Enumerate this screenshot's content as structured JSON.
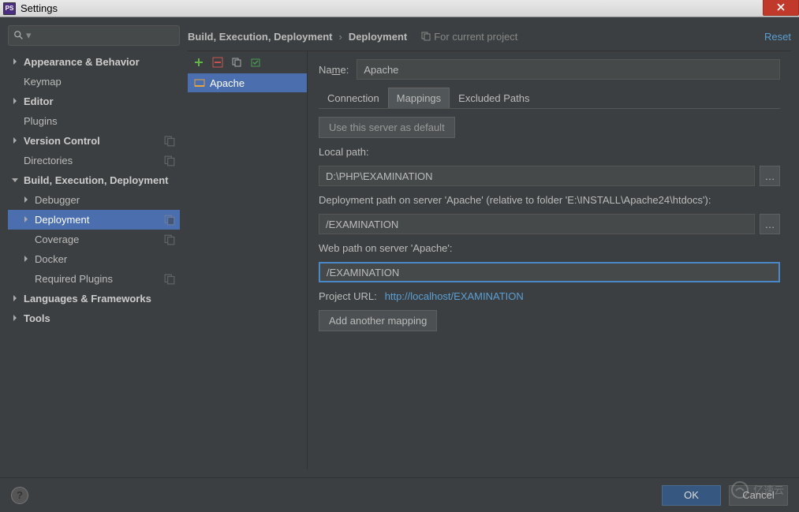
{
  "window": {
    "title": "Settings",
    "icon_text": "PS"
  },
  "search": {
    "placeholder": ""
  },
  "sidebar": {
    "items": [
      {
        "label": "Appearance & Behavior",
        "arrow": "right",
        "bold": true,
        "indent": 0
      },
      {
        "label": "Keymap",
        "arrow": "none",
        "bold": false,
        "indent": 0
      },
      {
        "label": "Editor",
        "arrow": "right",
        "bold": true,
        "indent": 0
      },
      {
        "label": "Plugins",
        "arrow": "none",
        "bold": false,
        "indent": 0
      },
      {
        "label": "Version Control",
        "arrow": "right",
        "bold": true,
        "indent": 0,
        "copy": true
      },
      {
        "label": "Directories",
        "arrow": "none",
        "bold": false,
        "indent": 0,
        "copy": true
      },
      {
        "label": "Build, Execution, Deployment",
        "arrow": "down",
        "bold": true,
        "indent": 0
      },
      {
        "label": "Debugger",
        "arrow": "right",
        "bold": false,
        "indent": 1
      },
      {
        "label": "Deployment",
        "arrow": "right",
        "bold": false,
        "indent": 1,
        "selected": true,
        "copy": true
      },
      {
        "label": "Coverage",
        "arrow": "none",
        "bold": false,
        "indent": 1,
        "copy": true
      },
      {
        "label": "Docker",
        "arrow": "right",
        "bold": false,
        "indent": 1
      },
      {
        "label": "Required Plugins",
        "arrow": "none",
        "bold": false,
        "indent": 1,
        "copy": true
      },
      {
        "label": "Languages & Frameworks",
        "arrow": "right",
        "bold": true,
        "indent": 0
      },
      {
        "label": "Tools",
        "arrow": "right",
        "bold": true,
        "indent": 0
      }
    ]
  },
  "breadcrumb": {
    "part1": "Build, Execution, Deployment",
    "part2": "Deployment",
    "for_project": "For current project",
    "reset": "Reset"
  },
  "servers": {
    "items": [
      {
        "name": "Apache"
      }
    ]
  },
  "detail": {
    "name_label_u": "m",
    "name_label_pre": "Na",
    "name_label_post": "e:",
    "name_value": "Apache",
    "tabs": {
      "connection": "Connection",
      "mappings": "Mappings",
      "excluded": "Excluded Paths"
    },
    "default_btn": "Use this server as default",
    "local_path_label_u": "L",
    "local_path_label_post": "ocal path:",
    "local_path_value": "D:\\PHP\\EXAMINATION",
    "deploy_path_label": "Deployment path on server 'Apache' (relative to folder 'E:\\INSTALL\\Apache24\\htdocs'):",
    "deploy_path_value": "/EXAMINATION",
    "web_path_label_u": "W",
    "web_path_label_post": "eb path on server 'Apache':",
    "web_path_value": "/EXAMINATION",
    "project_url_label": "Project URL:",
    "project_url_value": "http://localhost/EXAMINATION",
    "add_mapping_pre": "A",
    "add_mapping_u": "d",
    "add_mapping_post": "d another mapping"
  },
  "footer": {
    "ok": "OK",
    "cancel": "Cancel",
    "help": "?"
  },
  "watermark": "亿速云"
}
